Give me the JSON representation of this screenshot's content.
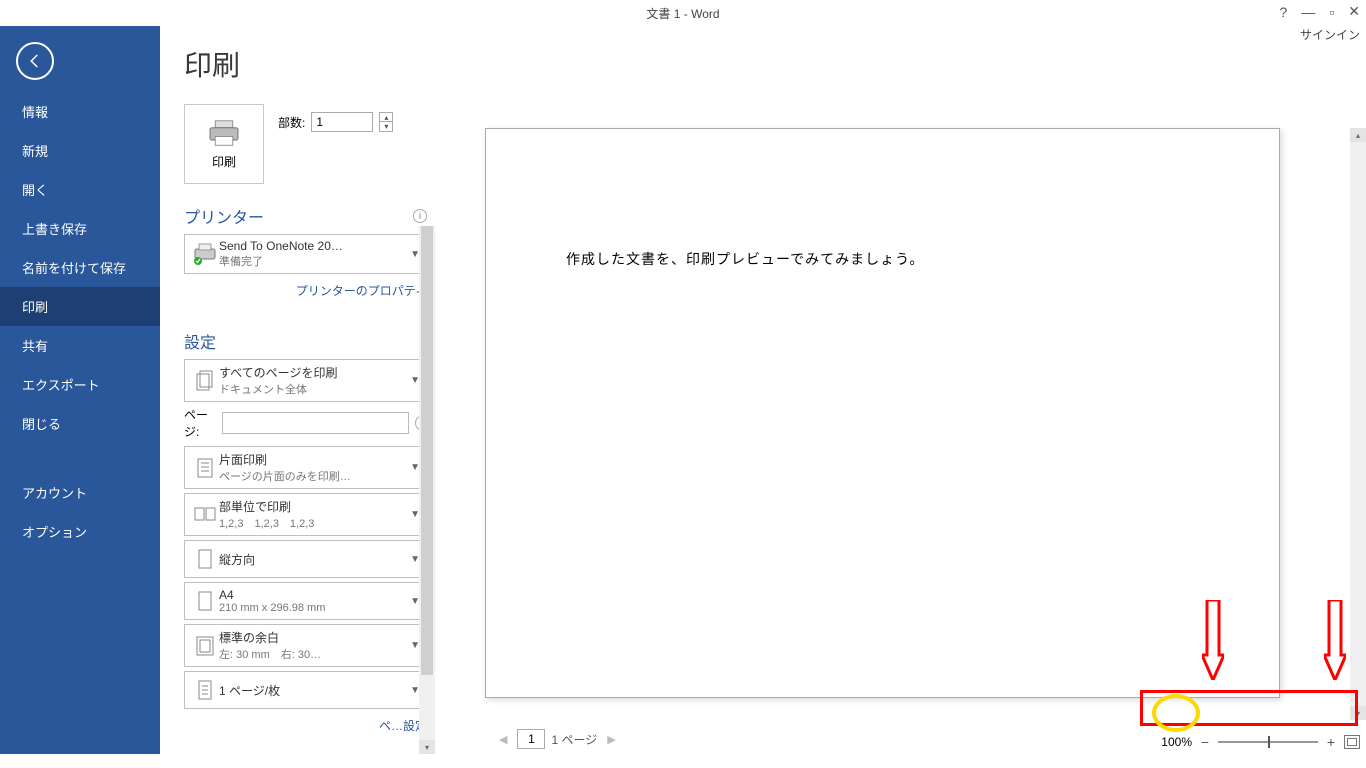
{
  "window": {
    "title": "文書 1 - Word",
    "signin": "サインイン"
  },
  "sidebar": {
    "items": [
      "情報",
      "新規",
      "開く",
      "上書き保存",
      "名前を付けて保存",
      "印刷",
      "共有",
      "エクスポート",
      "閉じる"
    ],
    "bottom": [
      "アカウント",
      "オプション"
    ]
  },
  "print": {
    "title": "印刷",
    "button": "印刷",
    "copies_label": "部数:",
    "copies_value": "1",
    "printer_section": "プリンター",
    "printer_name": "Send To OneNote 20…",
    "printer_status": "準備完了",
    "printer_props": "プリンターのプロパティ",
    "settings_section": "設定",
    "settings": [
      {
        "main": "すべてのページを印刷",
        "sub": "ドキュメント全体"
      },
      {
        "main": "片面印刷",
        "sub": "ページの片面のみを印刷…"
      },
      {
        "main": "部単位で印刷",
        "sub": "1,2,3　1,2,3　1,2,3"
      },
      {
        "main": "縦方向",
        "sub": ""
      },
      {
        "main": "A4",
        "sub": "210 mm x 296.98 mm"
      },
      {
        "main": "標準の余白",
        "sub": "左: 30 mm　右: 30…"
      },
      {
        "main": "1 ページ/枚",
        "sub": ""
      }
    ],
    "pages_label": "ページ:",
    "page_setup_trunc": "ペ…設定"
  },
  "preview": {
    "document_text": "作成した文書を、印刷プレビューでみてみましょう。",
    "page_input": "1",
    "page_total": "1 ページ",
    "zoom": "100%"
  }
}
